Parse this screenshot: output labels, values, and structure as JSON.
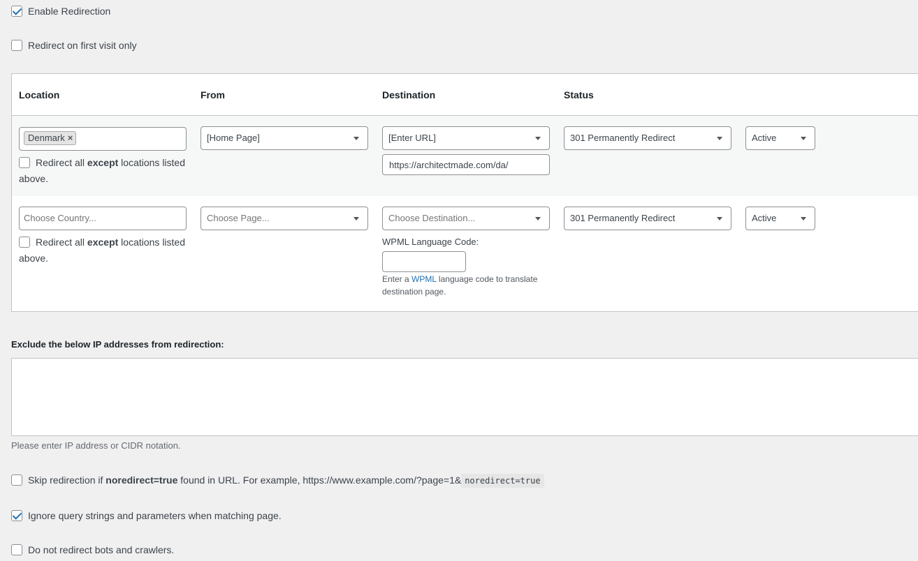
{
  "settings": {
    "enable_redirection": {
      "label": "Enable Redirection",
      "checked": true
    },
    "first_visit_only": {
      "label": "Redirect on first visit only",
      "checked": false
    }
  },
  "table": {
    "headers": {
      "location": "Location",
      "from": "From",
      "destination": "Destination",
      "status": "Status"
    },
    "rows": [
      {
        "location_tag": "Denmark",
        "tag_remove": "×",
        "except_pre": "Redirect all ",
        "except_bold": "except",
        "except_post": " locations listed",
        "except_line2": "above.",
        "from": "[Home Page]",
        "destination": "[Enter URL]",
        "url": "https://architectmade.com/da/",
        "redirect_type": "301 Permanently Redirect",
        "status": "Active"
      },
      {
        "location_placeholder": "Choose Country...",
        "except_pre": "Redirect all ",
        "except_bold": "except",
        "except_post": " locations listed",
        "except_line2": "above.",
        "from_placeholder": "Choose Page...",
        "destination_placeholder": "Choose Destination...",
        "wpml_label": "WPML Language Code:",
        "wpml_value": "",
        "help_pre": "Enter a ",
        "help_link": "WPML",
        "help_post": " language code to translate",
        "help_line2": "destination page.",
        "redirect_type": "301 Permanently Redirect",
        "status": "Active"
      }
    ]
  },
  "exclude": {
    "label": "Exclude the below IP addresses from redirection:",
    "value": "",
    "help": "Please enter IP address or CIDR notation."
  },
  "options": {
    "skip_noredirect": {
      "checked": false,
      "pre": "Skip redirection if ",
      "bold": "noredirect=true",
      "post": " found in URL. For example, https://www.example.com/?page=1&",
      "code": "noredirect=true"
    },
    "ignore_query": {
      "checked": true,
      "label": "Ignore query strings and parameters when matching page."
    },
    "no_bots": {
      "checked": false,
      "label": "Do not redirect bots and crawlers."
    }
  }
}
